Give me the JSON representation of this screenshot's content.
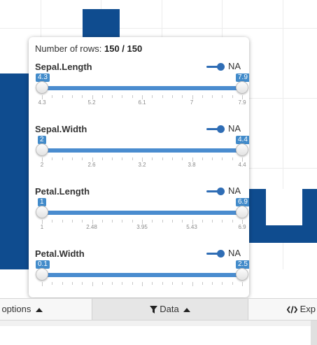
{
  "row_count": {
    "label": "Number of rows:",
    "value": "150 / 150"
  },
  "variables": [
    {
      "name": "Sepal.Length",
      "min": "4.3",
      "max": "7.9",
      "ticks": [
        "4.3",
        "5.2",
        "6.1",
        "7",
        "7.9"
      ],
      "na_label": "NA",
      "na_enabled": true
    },
    {
      "name": "Sepal.Width",
      "min": "2",
      "max": "4.4",
      "ticks": [
        "2",
        "2.6",
        "3.2",
        "3.8",
        "4.4"
      ],
      "na_label": "NA",
      "na_enabled": true
    },
    {
      "name": "Petal.Length",
      "min": "1",
      "max": "6.9",
      "ticks": [
        "1",
        "2.48",
        "3.95",
        "5.43",
        "6.9"
      ],
      "na_label": "NA",
      "na_enabled": true
    },
    {
      "name": "Petal.Width",
      "min": "0.1",
      "max": "2.5",
      "ticks": [],
      "na_label": "NA",
      "na_enabled": true
    }
  ],
  "tabs": {
    "plot_options": "ot options",
    "data": "Data",
    "export": "Exp"
  },
  "colors": {
    "accent": "#428bca",
    "bars": "#0f4c8f"
  }
}
